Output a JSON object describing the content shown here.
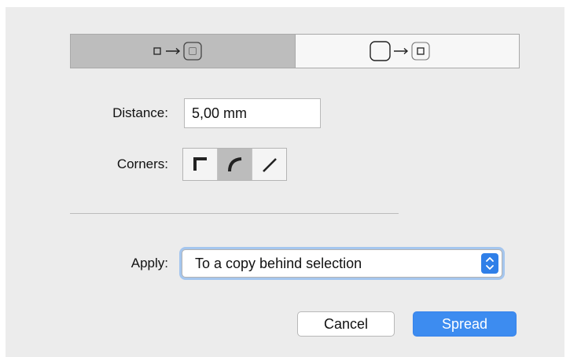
{
  "mode_control": {
    "segments": [
      {
        "name": "expand-outward",
        "selected": true
      },
      {
        "name": "shrink-inward",
        "selected": false
      }
    ]
  },
  "distance": {
    "label": "Distance:",
    "value": "5,00 mm"
  },
  "corners": {
    "label": "Corners:",
    "options": [
      "square-corner-icon",
      "round-corner-icon",
      "bevel-corner-icon"
    ],
    "selected": "round-corner-icon"
  },
  "apply": {
    "label": "Apply:",
    "selected_value": "To a copy behind selection"
  },
  "buttons": {
    "cancel_label": "Cancel",
    "default_label": "Spread"
  },
  "colors": {
    "accent": "#3d8cf0",
    "dialog_background": "#ececec",
    "selected_segment": "#bdbdbd"
  }
}
